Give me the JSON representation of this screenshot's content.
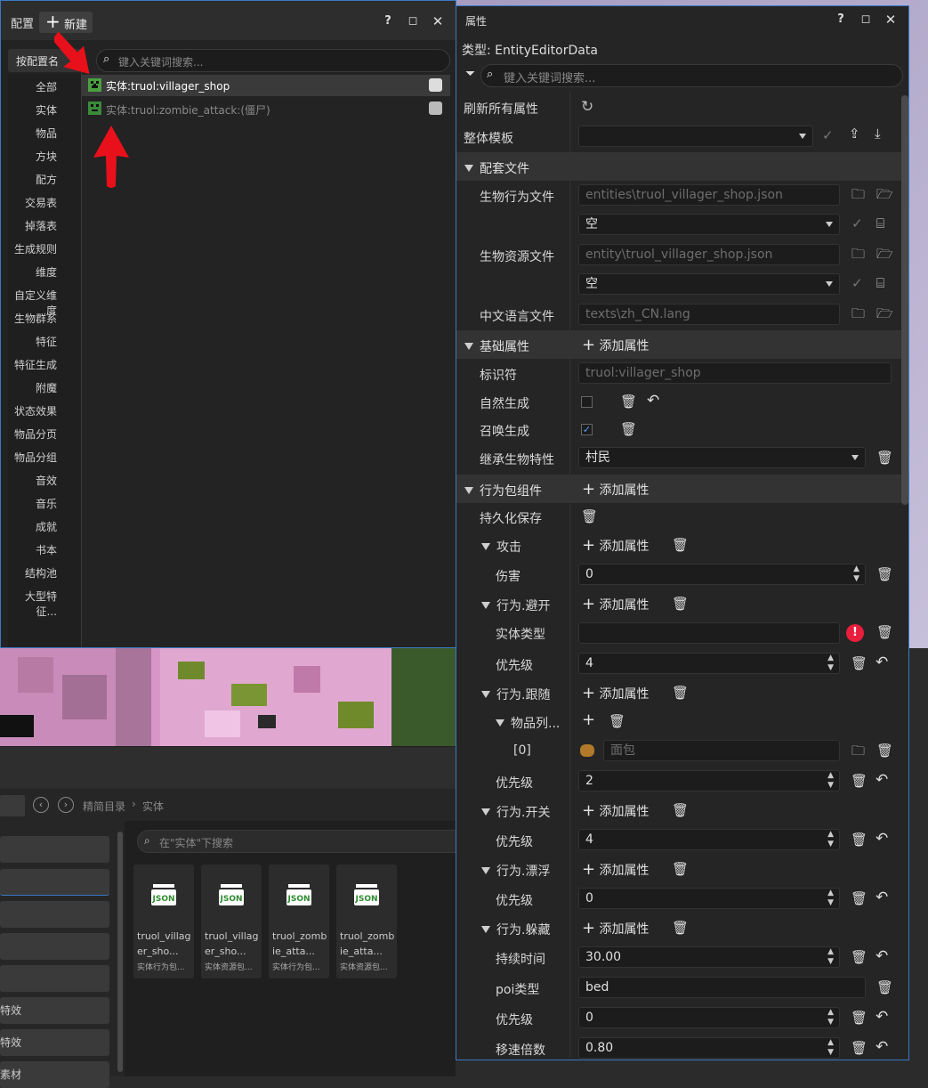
{
  "config_panel": {
    "title": "配置",
    "new_label": "新建",
    "filter_label": "按配置名",
    "search_placeholder": "键入关键词搜索...",
    "categories": [
      "全部",
      "实体",
      "物品",
      "方块",
      "配方",
      "交易表",
      "掉落表",
      "生成规则",
      "维度",
      "自定义维度",
      "生物群系",
      "特征",
      "特征生成",
      "附魔",
      "状态效果",
      "物品分页",
      "物品分组",
      "音效",
      "音乐",
      "成就",
      "书本",
      "结构池",
      "大型特征..."
    ],
    "items": [
      {
        "label": "实体:truol:villager_shop"
      },
      {
        "label": "实体:truol:zombie_attack:(僵尸)"
      }
    ]
  },
  "props_panel": {
    "title": "属性",
    "type_label": "类型: EntityEditorData",
    "search_placeholder": "键入关键词搜索...",
    "refresh_label": "刷新所有属性",
    "template_label": "整体模板",
    "template_value": "",
    "section_files": "配套文件",
    "behavior_file_label": "生物行为文件",
    "behavior_file_value": "entities\\truol_villager_shop.json",
    "behavior_select": "空",
    "resource_file_label": "生物资源文件",
    "resource_file_value": "entity\\truol_villager_shop.json",
    "resource_select": "空",
    "lang_file_label": "中文语言文件",
    "lang_file_value": "texts\\zh_CN.lang",
    "section_basic": "基础属性",
    "add_attr": "添加属性",
    "identifier_label": "标识符",
    "identifier_value": "truol:villager_shop",
    "natural_spawn_label": "自然生成",
    "natural_spawn_checked": false,
    "summon_spawn_label": "召唤生成",
    "summon_spawn_checked": true,
    "inherit_label": "继承生物特性",
    "inherit_value": "村民",
    "section_behavior": "行为包组件",
    "persist_label": "持久化保存",
    "attack_label": "攻击",
    "damage_label": "伤害",
    "damage_value": "0",
    "avoid_label": "行为.避开",
    "entity_type_label": "实体类型",
    "entity_type_value": "",
    "priority_label": "优先级",
    "avoid_priority": "4",
    "follow_label": "行为.跟随",
    "item_list_label": "物品列...",
    "index_label": "[0]",
    "item0_value": "面包",
    "follow_priority": "2",
    "open_label": "行为.开关",
    "open_priority": "4",
    "float_label": "行为.漂浮",
    "float_priority": "0",
    "hide_label": "行为.躲藏",
    "duration_label": "持续时间",
    "duration_value": "30.00",
    "poi_label": "poi类型",
    "poi_value": "bed",
    "hide_priority": "0",
    "speed_label": "移速倍数",
    "speed_value": "0.80"
  },
  "browser": {
    "breadcrumb_root": "精简目录",
    "breadcrumb_current": "实体",
    "search_placeholder": "在\"实体\"下搜索",
    "side_items": [
      "",
      "",
      "",
      "",
      "",
      "特效",
      "特效",
      "素材"
    ],
    "files": [
      {
        "icon": "JSON",
        "name": "truol_villager_sho...",
        "sub": "实体行为包..."
      },
      {
        "icon": "JSON",
        "name": "truol_villager_sho...",
        "sub": "实体资源包..."
      },
      {
        "icon": "JSON",
        "name": "truol_zombie_atta...",
        "sub": "实体行为包..."
      },
      {
        "icon": "JSON",
        "name": "truol_zombie_atta...",
        "sub": "实体资源包..."
      }
    ]
  },
  "colors": {
    "accent": "#3b78c4",
    "arrow": "#e8101a",
    "error": "#e81e3c"
  }
}
